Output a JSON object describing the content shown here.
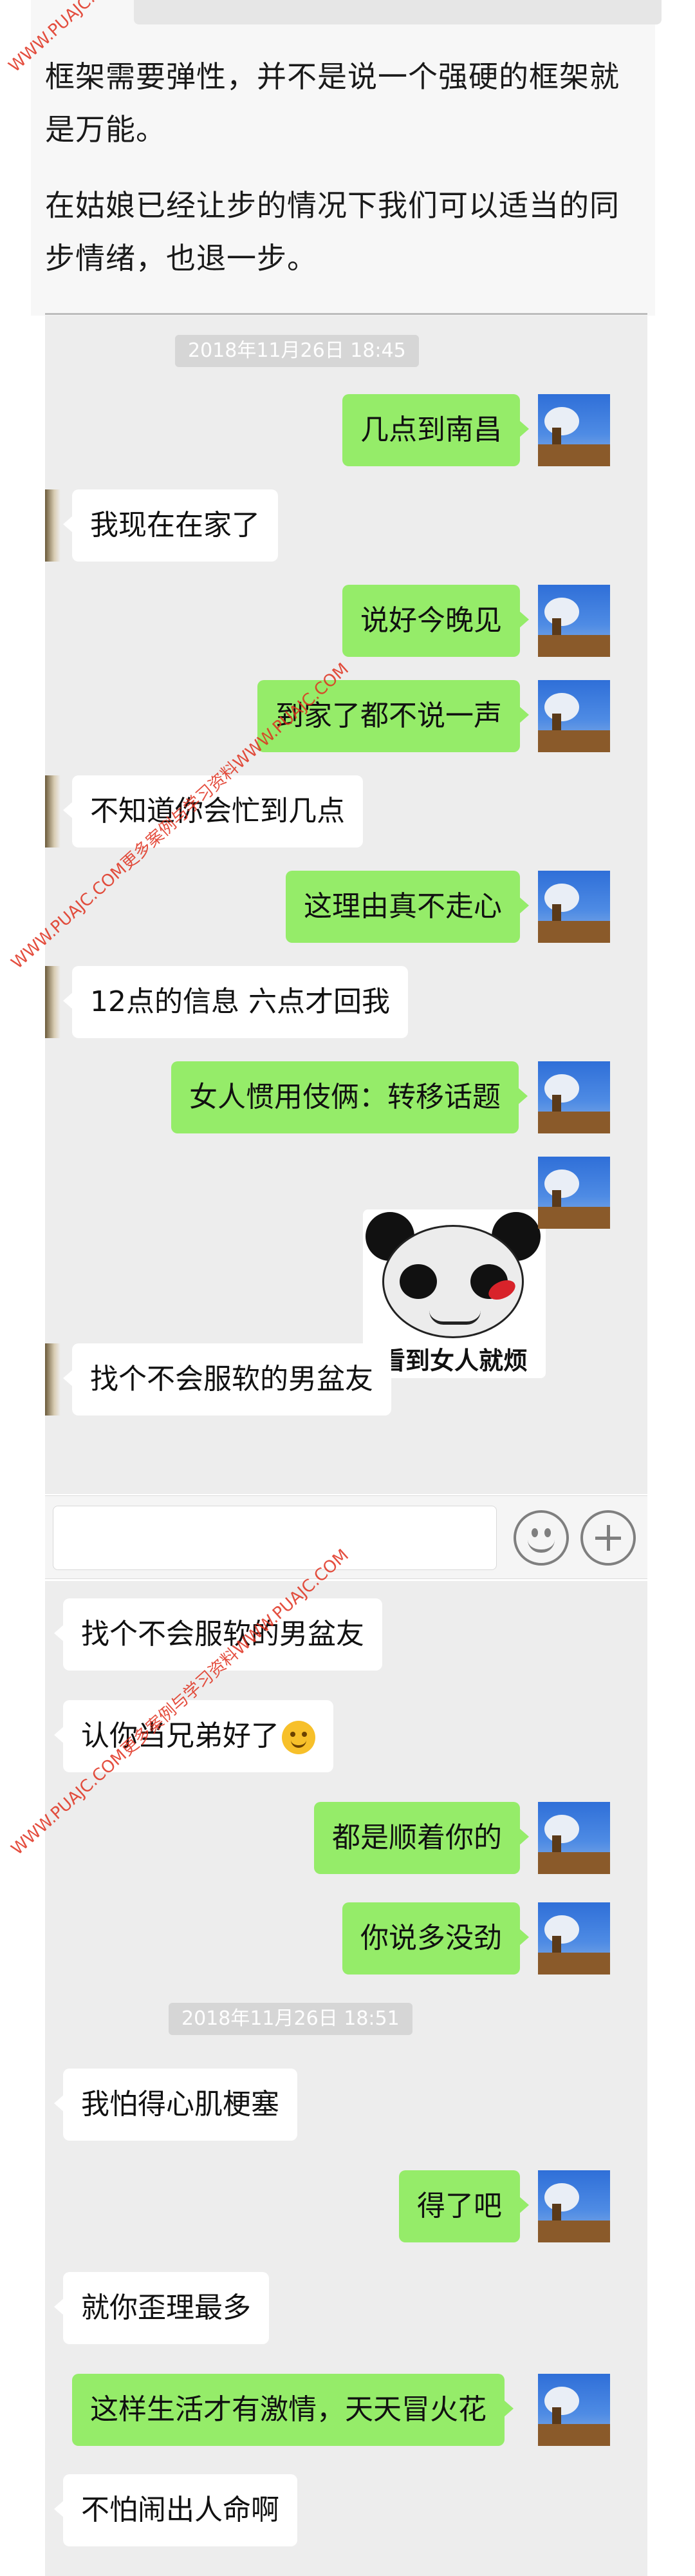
{
  "article": {
    "paragraph1": "框架需要弹性，并不是说一个强硬的框架就是万能。",
    "paragraph2": "在姑娘已经让步的情况下我们可以适当的同步情绪，也退一步。"
  },
  "watermark": {
    "text1": "WWW.PUAJC.COM",
    "text2": "WWW.PUAJC.COM更多案例与学习资料WWW.PUAJC.COM",
    "text3": "WWW.PUAJC.COM更多案例与学习资料WWW.PUAJC.COM"
  },
  "chat1": {
    "timestamp": "2018年11月26日 18:45",
    "messages": [
      {
        "side": "me",
        "text": "几点到南昌"
      },
      {
        "side": "other",
        "text": "我现在在家了"
      },
      {
        "side": "me",
        "text": "说好今晚见"
      },
      {
        "side": "me",
        "text": "到家了都不说一声"
      },
      {
        "side": "other",
        "text": "不知道你会忙到几点"
      },
      {
        "side": "me",
        "text": "这理由真不走心"
      },
      {
        "side": "other",
        "text": "12点的信息 六点才回我"
      },
      {
        "side": "me",
        "text": "女人惯用伎俩：转移话题"
      },
      {
        "side": "me",
        "sticker_caption": "看到女人就烦"
      },
      {
        "side": "other",
        "text": "找个不会服软的男盆友"
      }
    ]
  },
  "input_bar": {
    "emoji_icon": "smiley-icon",
    "plus_icon": "plus-icon"
  },
  "chat2": {
    "timestamp": "2018年11月26日 18:51",
    "messages": [
      {
        "side": "other",
        "text": "找个不会服软的男盆友"
      },
      {
        "side": "other",
        "text": "认你当兄弟好了",
        "emoji": "smirk-emoji"
      },
      {
        "side": "me",
        "text": "都是顺着你的"
      },
      {
        "side": "me",
        "text": "你说多没劲"
      },
      {
        "side": "other",
        "text": "我怕得心肌梗塞"
      },
      {
        "side": "me",
        "text": "得了吧"
      },
      {
        "side": "other",
        "text": "就你歪理最多"
      },
      {
        "side": "me",
        "text": "这样生活才有激情，天天冒火花"
      },
      {
        "side": "other",
        "text": "不怕闹出人命啊"
      }
    ]
  },
  "colors": {
    "my_bubble": "#95ec69",
    "other_bubble": "#ffffff",
    "chat_background": "#ededed",
    "watermark": "#e0301e"
  }
}
